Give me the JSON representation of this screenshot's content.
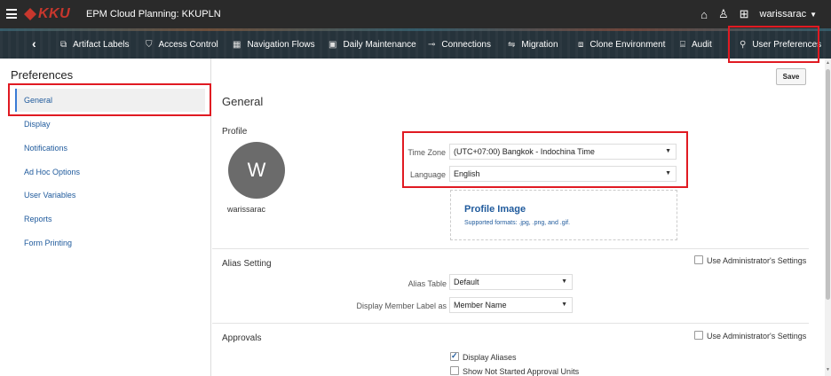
{
  "app": {
    "logo": "KKU",
    "title": "EPM Cloud Planning:  KKUPLN",
    "user": "warissarac"
  },
  "topbar_icons": [
    "home-icon",
    "accessibility-icon",
    "grid-navigator-icon"
  ],
  "nav": {
    "items": [
      {
        "label": "Artifact Labels",
        "icon": "artifact-labels-icon"
      },
      {
        "label": "Access Control",
        "icon": "shield-icon"
      },
      {
        "label": "Navigation Flows",
        "icon": "navigation-flows-icon"
      },
      {
        "label": "Daily Maintenance",
        "icon": "daily-maintenance-icon"
      },
      {
        "label": "Connections",
        "icon": "connections-icon"
      },
      {
        "label": "Migration",
        "icon": "migration-icon"
      },
      {
        "label": "Clone Environment",
        "icon": "clone-environment-icon"
      },
      {
        "label": "Audit",
        "icon": "audit-icon"
      },
      {
        "label": "User Preferences",
        "icon": "user-preferences-icon"
      }
    ]
  },
  "sidebar": {
    "title": "Preferences",
    "items": [
      {
        "label": "General",
        "selected": true
      },
      {
        "label": "Display"
      },
      {
        "label": "Notifications"
      },
      {
        "label": "Ad Hoc Options"
      },
      {
        "label": "User Variables"
      },
      {
        "label": "Reports"
      },
      {
        "label": "Form Printing"
      }
    ]
  },
  "main": {
    "save_label": "Save",
    "heading": "General",
    "profile": {
      "section_label": "Profile",
      "avatar_initial": "W",
      "username": "warissarac",
      "time_zone_label": "Time Zone",
      "time_zone_value": "(UTC+07:00) Bangkok - Indochina Time",
      "language_label": "Language",
      "language_value": "English",
      "profile_image_title": "Profile Image",
      "profile_image_formats": "Supported formats: .jpg, .png, and .gif."
    },
    "alias": {
      "section_label": "Alias Setting",
      "use_admin_label": "Use Administrator's Settings",
      "alias_table_label": "Alias Table",
      "alias_table_value": "Default",
      "member_label_label": "Display Member Label as",
      "member_label_value": "Member Name"
    },
    "approvals": {
      "section_label": "Approvals",
      "use_admin_label": "Use Administrator's Settings",
      "display_aliases_label": "Display Aliases",
      "display_aliases_checked": true,
      "show_not_started_label": "Show Not Started Approval Units",
      "show_not_started_checked": false
    }
  },
  "colors": {
    "highlight": "#e01a22",
    "link": "#1f5a9c",
    "navbar": "#26333b",
    "topbar": "#2a2a2a"
  }
}
